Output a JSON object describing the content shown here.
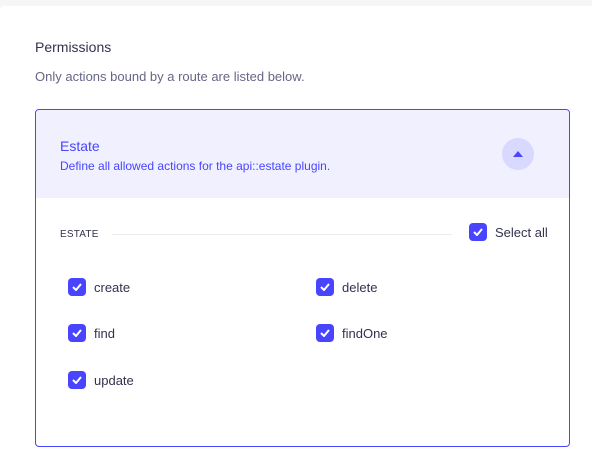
{
  "permissions": {
    "title": "Permissions",
    "subtitle": "Only actions bound by a route are listed below."
  },
  "accordion": {
    "title": "Estate",
    "description": "Define all allowed actions for the api::estate plugin.",
    "expanded": true,
    "section_label": "ESTATE",
    "select_all_label": "Select all",
    "select_all_checked": true,
    "actions": [
      {
        "label": "create",
        "checked": true
      },
      {
        "label": "delete",
        "checked": true
      },
      {
        "label": "find",
        "checked": true
      },
      {
        "label": "findOne",
        "checked": true
      },
      {
        "label": "update",
        "checked": true
      }
    ]
  },
  "colors": {
    "primary": "#4945ff",
    "header_bg": "#f0f0ff",
    "text": "#32324d",
    "muted": "#666687"
  },
  "icons": {
    "toggle": "chevron-up-icon",
    "check": "check-icon"
  }
}
